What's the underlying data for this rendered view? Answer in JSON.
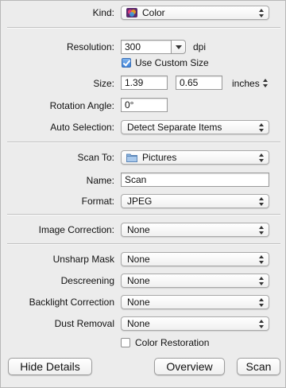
{
  "kind": {
    "label": "Kind:",
    "value": "Color",
    "icon": "color-kind-icon"
  },
  "resolution": {
    "label": "Resolution:",
    "value": "300",
    "unit": "dpi"
  },
  "custom_size": {
    "label": "Use Custom Size",
    "checked": true
  },
  "size": {
    "label": "Size:",
    "width": "1.39",
    "height": "0.65",
    "unit": "inches"
  },
  "rotation": {
    "label": "Rotation Angle:",
    "value": "0°"
  },
  "auto_selection": {
    "label": "Auto Selection:",
    "value": "Detect Separate Items"
  },
  "scan_to": {
    "label": "Scan To:",
    "value": "Pictures",
    "icon": "folder-icon"
  },
  "name": {
    "label": "Name:",
    "value": "Scan"
  },
  "format": {
    "label": "Format:",
    "value": "JPEG"
  },
  "image_correction": {
    "label": "Image Correction:",
    "value": "None"
  },
  "unsharp_mask": {
    "label": "Unsharp Mask",
    "value": "None"
  },
  "descreening": {
    "label": "Descreening",
    "value": "None"
  },
  "backlight": {
    "label": "Backlight Correction",
    "value": "None"
  },
  "dust_removal": {
    "label": "Dust Removal",
    "value": "None"
  },
  "color_restoration": {
    "label": "Color Restoration",
    "checked": false
  },
  "buttons": {
    "hide_details": "Hide Details",
    "overview": "Overview",
    "scan": "Scan"
  }
}
